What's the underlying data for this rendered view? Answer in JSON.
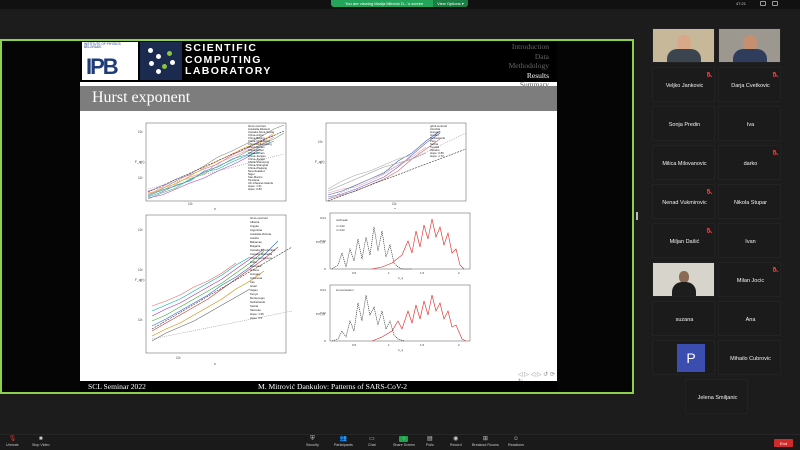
{
  "topbar": {
    "share_notice": "You are viewing Marija Mitrović D...'s screen",
    "view_options": "View Options ▾",
    "clock": "47:21"
  },
  "slide": {
    "ipb_small_line1": "INSTITUTE OF PHYSICS",
    "ipb_small_line2": "BELGRADE",
    "ipb_logo_text": "IPB",
    "scl_line1": "SCIENTIFIC",
    "scl_line2": "COMPUTING",
    "scl_line3": "LABORATORY",
    "nav": [
      "Introduction",
      "Data",
      "Methodology",
      "Results",
      "Summary"
    ],
    "nav_active": "Results",
    "title": "Hurst exponent",
    "footer_left": "SCL Seminar 2022",
    "footer_right": "M. Mitrović Dankulov:  Patterns of SARS-CoV-2",
    "controls": "◁ ▷ ◁ ▷ ↺ ⟳ ↻"
  },
  "plots": {
    "tl": {
      "ylabel": "F_q(n)",
      "xlabel": "n",
      "x_ticks": [
        "10",
        "10²"
      ],
      "y_ticks": [
        "10²",
        "10¹"
      ],
      "legend": [
        "G1v1-centroid",
        "Australia-Western",
        "Canada-Nova-Scotia",
        "China-Anhui",
        "China-Beijing",
        "China-Chongqing",
        "China-Heilongjiang",
        "China-Henan",
        "China-Hubei",
        "China-Hunan",
        "China-Jiangsu",
        "China-Jiangxi",
        "China-Shandong",
        "China-Shanghai",
        "China-Zhejiang",
        "New-Zealand",
        "Niger",
        "San-Marino",
        "Tanzania",
        "UK-Channel-Islands",
        "slope: 1.61",
        "slope: 0.83"
      ]
    },
    "tr": {
      "ylabel": "F_q(n)",
      "xlabel": "n",
      "x_ticks": [
        "10",
        "10²"
      ],
      "y_ticks": [
        "10²",
        "10¹"
      ],
      "legend": [
        "g2c3-centroid",
        "Czechia",
        "Hungary",
        "Jordan",
        "Netherlands",
        "Peru",
        "Serbia",
        "Tunisia",
        "Ukraine",
        "slope: 0.80",
        "slope: 1.70"
      ]
    },
    "bl": {
      "ylabel": "F_q(n)",
      "xlabel": "n",
      "x_ticks": [
        "10",
        "10²"
      ],
      "y_ticks": [
        "10³",
        "10²",
        "10¹"
      ],
      "legend": [
        "G1v1-centroid",
        "Albania",
        "Angola",
        "Argentina",
        "Australia-Victoria",
        "Austria",
        "Bahamas",
        "Bulgaria",
        "Canada-B.Columbia",
        "Canada-Manitoba",
        "China-HongKong",
        "Cuba",
        "Denmark",
        "Greece",
        "Hungary",
        "Indonesia",
        "Iran",
        "Israel",
        "Japan",
        "Kenya",
        "Montenegro",
        "Netherlands",
        "Serbia",
        "Slovenia",
        "slope: 1.65",
        "slope: 0.5"
      ]
    },
    "br1": {
      "label": "outbreak",
      "legend": [
        "n<14d",
        "n>14d"
      ],
      "ylabel": "P(h_q)",
      "xlabel": "h_q",
      "x_ticks": [
        "0.5",
        "1",
        "1.5",
        "2"
      ],
      "y_ticks": [
        "0.04",
        "0.02",
        "0"
      ]
    },
    "br2": {
      "label": "immunisation",
      "legend": [
        "n<14d",
        "n>14d"
      ],
      "ylabel": "P(h_q)",
      "xlabel": "h_q",
      "x_ticks": [
        "0.5",
        "1",
        "1.5",
        "2"
      ],
      "y_ticks": [
        "0.04",
        "0.02",
        "0"
      ]
    }
  },
  "participants": [
    {
      "name": "",
      "video": true,
      "label": ""
    },
    {
      "name": "",
      "video": true,
      "label": ""
    },
    {
      "name": "Veljko Jankovic",
      "video": false
    },
    {
      "name": "Darja Cvetkovic",
      "video": false
    },
    {
      "name": "Sonja Predin",
      "video": false
    },
    {
      "name": "Iva",
      "video": false
    },
    {
      "name": "Milica Milovanovic",
      "video": false
    },
    {
      "name": "darko",
      "video": false
    },
    {
      "name": "Nenad Vukmirovic",
      "video": false
    },
    {
      "name": "Nikola Stupar",
      "video": false
    },
    {
      "name": "Miljan Dašić",
      "video": false
    },
    {
      "name": "Ivan",
      "video": false
    },
    {
      "name": "",
      "video": true
    },
    {
      "name": "Milan Jocic",
      "video": false
    },
    {
      "name": "suzana",
      "video": false
    },
    {
      "name": "Ana",
      "video": false
    },
    {
      "name": "P",
      "video": false,
      "avatar": true
    },
    {
      "name": "Mihailo Cubrovic",
      "video": false
    },
    {
      "name": "Jelena Smiljanic",
      "video": false
    }
  ],
  "toolbar": {
    "unmute": "Unmute",
    "start_video": "Stop Video",
    "security": "Security",
    "participants": "Participants",
    "participants_count": "19",
    "chat": "Chat",
    "share_screen": "Share Screen",
    "polls": "Polls",
    "record": "Record",
    "breakout": "Breakout Rooms",
    "reactions": "Reactions",
    "end": "End"
  }
}
